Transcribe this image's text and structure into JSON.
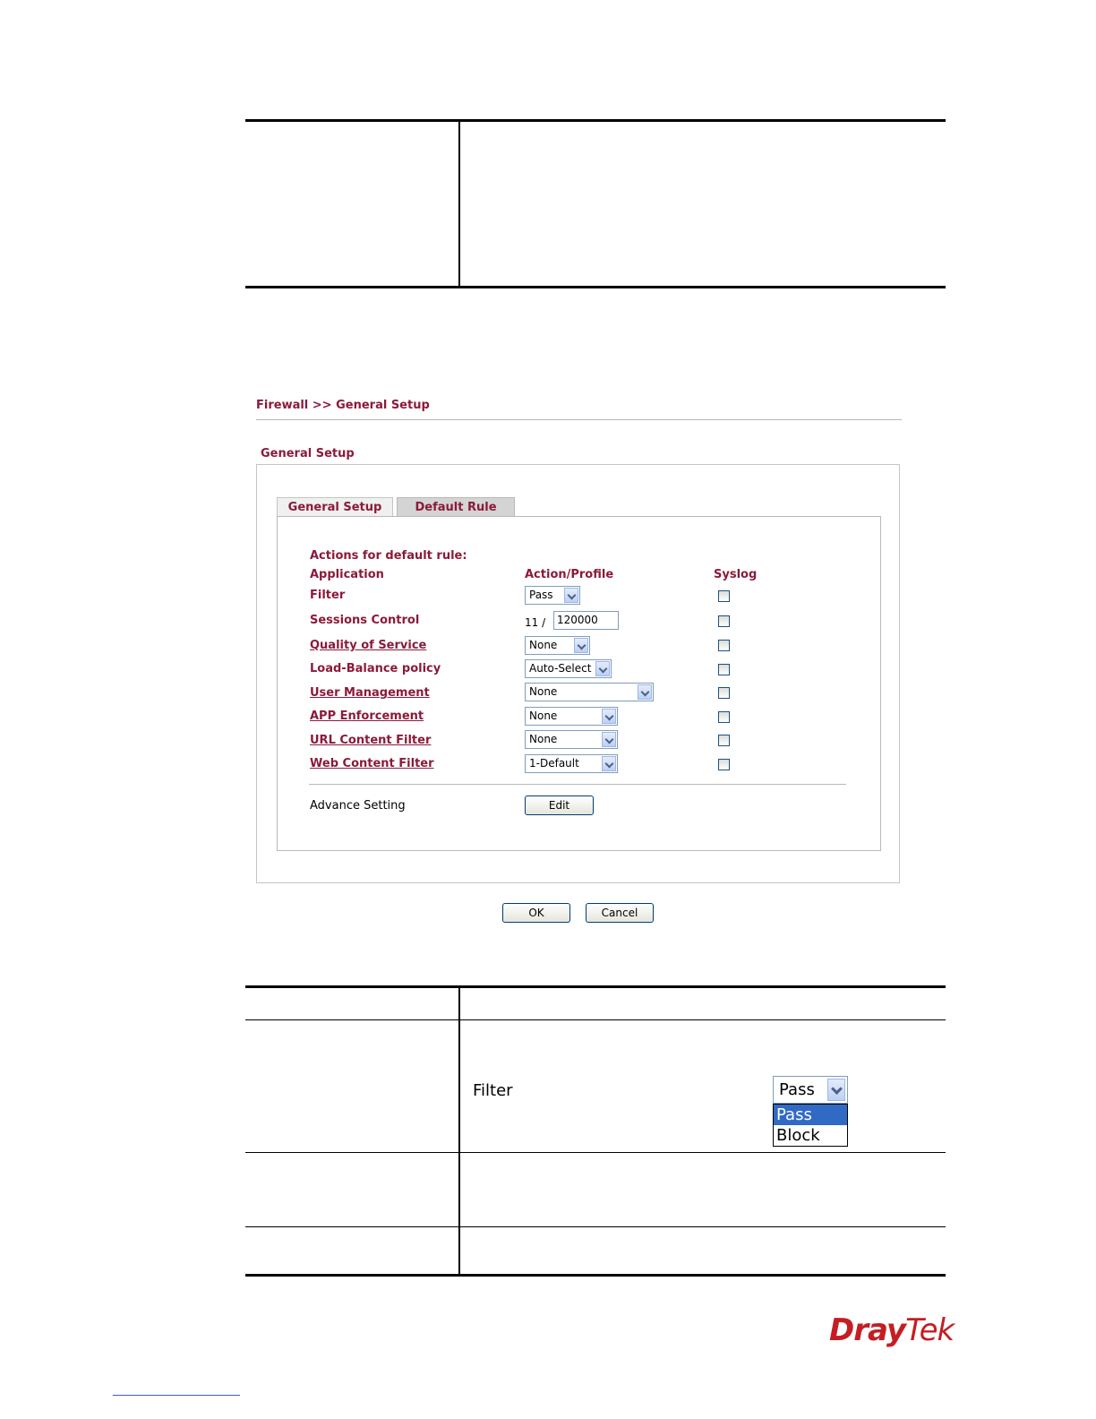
{
  "breadcrumb": "Firewall >> General Setup",
  "section_title": "General Setup",
  "tabs": [
    {
      "label": "General Setup"
    },
    {
      "label": "Default Rule"
    }
  ],
  "form": {
    "heading": "Actions for default rule:",
    "columns": {
      "application": "Application",
      "action": "Action/Profile",
      "syslog": "Syslog"
    },
    "rows": {
      "filter": {
        "label": "Filter",
        "value": "Pass"
      },
      "sessions": {
        "label": "Sessions Control",
        "prefix": "11 /",
        "value": "120000"
      },
      "qos": {
        "label": "Quality of Service",
        "value": "None"
      },
      "load_balance": {
        "label": "Load-Balance policy",
        "value": "Auto-Select"
      },
      "user_mgmt": {
        "label": "User Management",
        "value": "None"
      },
      "app_enf": {
        "label": "APP Enforcement",
        "value": "None"
      },
      "url_filter": {
        "label": "URL Content Filter",
        "value": "None"
      },
      "web_filter": {
        "label": "Web Content Filter",
        "value": "1-Default"
      }
    },
    "advance_label": "Advance Setting",
    "edit_label": "Edit"
  },
  "buttons": {
    "ok": "OK",
    "cancel": "Cancel"
  },
  "example": {
    "label": "Filter",
    "selected": "Pass",
    "options": [
      "Pass",
      "Block"
    ]
  },
  "logo": {
    "dray": "Dray",
    "tek": "Tek"
  }
}
